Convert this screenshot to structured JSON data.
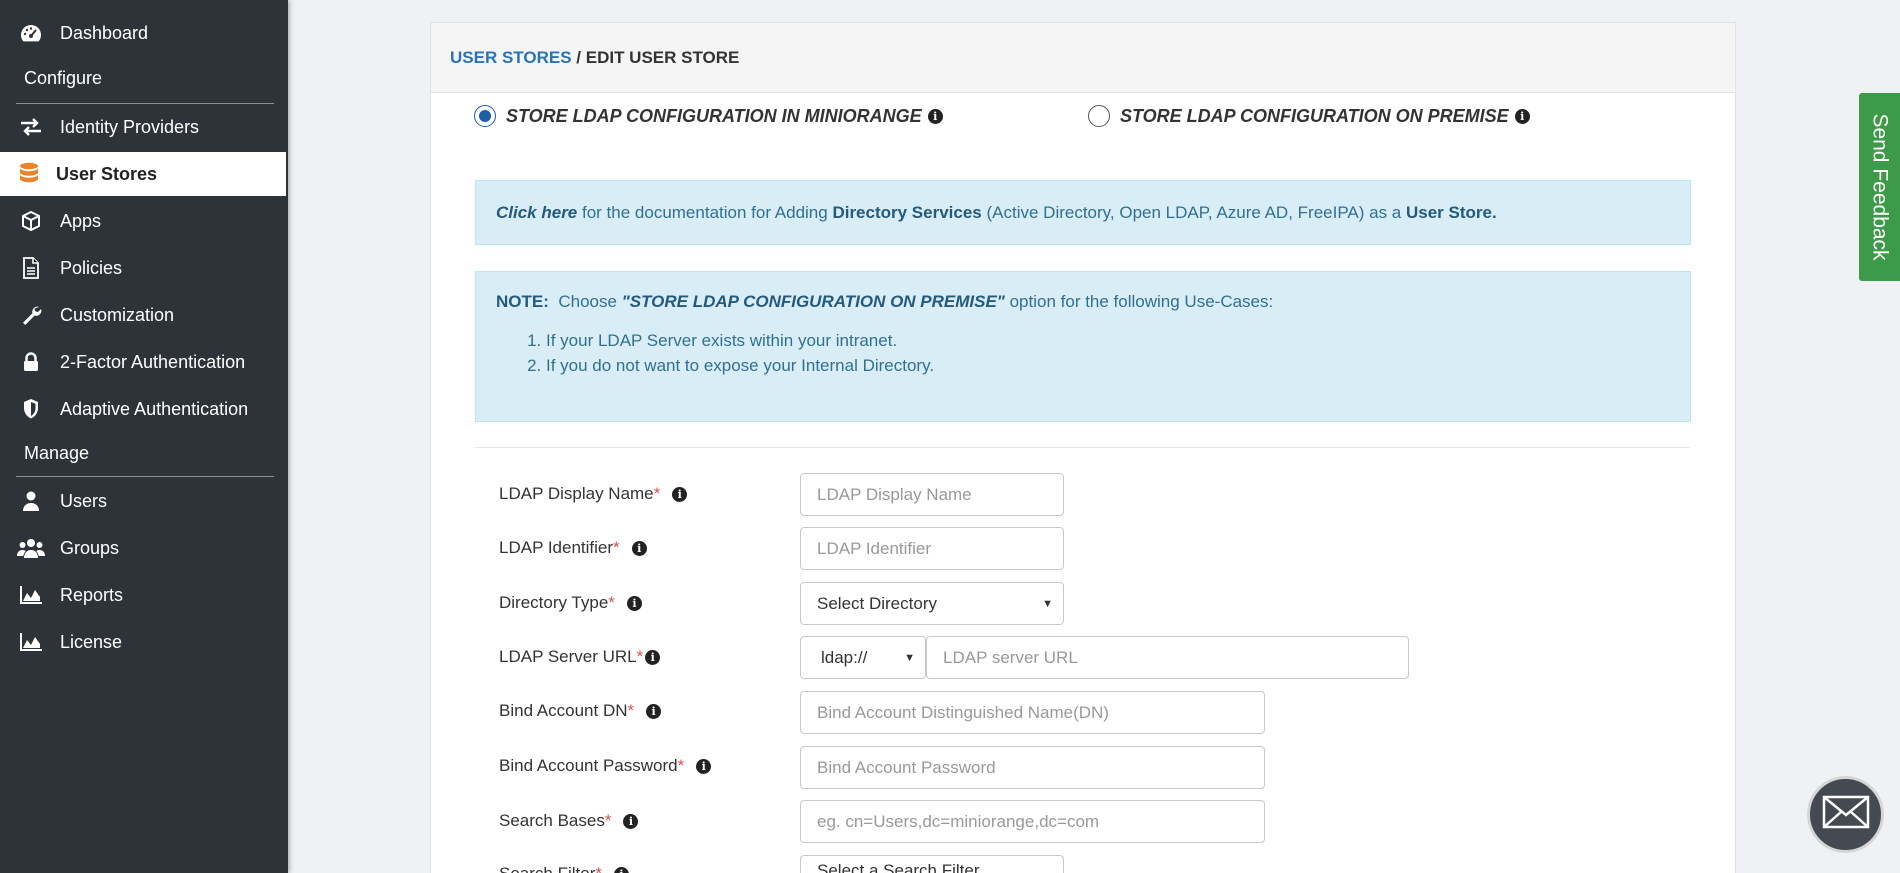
{
  "sidebar": {
    "items_top": [
      {
        "label": "Dashboard",
        "icon": "dashboard-icon"
      }
    ],
    "section_configure": "Configure",
    "items_configure": [
      {
        "label": "Identity Providers",
        "icon": "exchange-icon"
      },
      {
        "label": "User Stores",
        "icon": "database-icon",
        "active": true
      },
      {
        "label": "Apps",
        "icon": "cube-icon"
      },
      {
        "label": "Policies",
        "icon": "document-icon"
      },
      {
        "label": "Customization",
        "icon": "wrench-icon"
      },
      {
        "label": "2-Factor Authentication",
        "icon": "lock-icon"
      },
      {
        "label": "Adaptive Authentication",
        "icon": "shield-icon"
      }
    ],
    "section_manage": "Manage",
    "items_manage": [
      {
        "label": "Users",
        "icon": "user-icon"
      },
      {
        "label": "Groups",
        "icon": "users-icon"
      },
      {
        "label": "Reports",
        "icon": "area-chart-icon"
      },
      {
        "label": "License",
        "icon": "area-chart-icon"
      }
    ]
  },
  "breadcrumb": {
    "link": "USER STORES",
    "separator": " / ",
    "current": "EDIT USER STORE"
  },
  "store_options": {
    "miniorange": {
      "label": "STORE LDAP CONFIGURATION IN MINIORANGE",
      "checked": true
    },
    "premise": {
      "label": "STORE LDAP CONFIGURATION ON PREMISE",
      "checked": false
    }
  },
  "doc_alert": {
    "link": "Click here",
    "text1": " for the documentation for Adding ",
    "bold1": "Directory Services",
    "text2": " (Active Directory, Open LDAP, Azure AD, FreeIPA) as a ",
    "bold2": "User Store."
  },
  "note_alert": {
    "label": "NOTE:",
    "text1": "  Choose ",
    "emphasis": "\"STORE LDAP CONFIGURATION ON PREMISE\"",
    "text2": " option for the following Use-Cases:",
    "items": [
      "If your LDAP Server exists within your intranet.",
      "If you do not want to expose your Internal Directory."
    ]
  },
  "form": {
    "display_name": {
      "label": "LDAP Display Name",
      "placeholder": "LDAP Display Name"
    },
    "identifier": {
      "label": "LDAP Identifier",
      "placeholder": "LDAP Identifier"
    },
    "directory_type": {
      "label": "Directory Type",
      "value": "Select Directory"
    },
    "server_url": {
      "label": "LDAP Server URL",
      "protocol": "ldap://",
      "placeholder": "LDAP server URL"
    },
    "bind_dn": {
      "label": "Bind Account DN",
      "placeholder": "Bind Account Distinguished Name(DN)"
    },
    "bind_password": {
      "label": "Bind Account Password",
      "placeholder": "Bind Account Password"
    },
    "search_bases": {
      "label": "Search Bases",
      "placeholder": "eg. cn=Users,dc=miniorange,dc=com"
    },
    "search_filter": {
      "label": "Search Filter",
      "value": "Select a Search Filter"
    },
    "required_mark": "*"
  },
  "feedback_label": "Send Feedback",
  "colors": {
    "sidebar_bg": "#2d3339",
    "link_blue": "#2a73b6",
    "alert_bg": "#d9edf7",
    "feedback_green": "#3c9a48",
    "required_red": "#d9534f",
    "active_icon_orange": "#e8842c"
  }
}
